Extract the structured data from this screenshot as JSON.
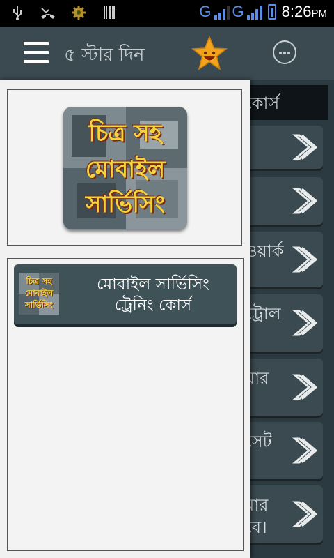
{
  "status_bar": {
    "icons": [
      "usb-icon",
      "missed-call-icon",
      "settings-gear-icon",
      "barcode-icon"
    ],
    "network_1": "G",
    "network_2": "G",
    "time": "8:26",
    "ampm": "PM"
  },
  "action_bar": {
    "menu_icon": "hamburger-menu-icon",
    "title": "৫ স্টার দিন",
    "rate_icon": "smiling-star-icon",
    "overflow_icon": "more-options-icon"
  },
  "background_list": {
    "header": "কোর্স",
    "items": [
      {
        "text": ""
      },
      {
        "text": ""
      },
      {
        "text": "ওয়ার্ক\n"
      },
      {
        "text": "ট্রোল\n"
      },
      {
        "text": "য়ার\n।"
      },
      {
        "text": "সেট\n"
      },
      {
        "text": "মার\nবে।"
      }
    ]
  },
  "drawer": {
    "logo_text": [
      "চিত্র সহ",
      "মোবাইল",
      "সার্ভিসিং"
    ],
    "course_button": {
      "thumb_text": [
        "চিত্র সহ",
        "মোবাইল",
        "সার্ভিসিং"
      ],
      "label_line1": "মোবাইল সার্ভিসিং",
      "label_line2": "ট্রেনিং কোর্স"
    }
  },
  "colors": {
    "action_bar": "#3b4a50",
    "drawer_bg": "#f1f1f1",
    "button_bg": "#3f5258",
    "accent_blue": "#5b8fe6",
    "star": "#f2a51c"
  }
}
